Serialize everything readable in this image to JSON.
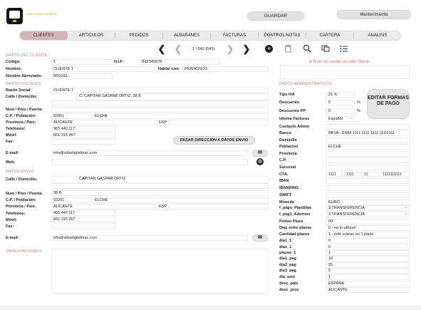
{
  "app": {
    "brand": "VIDA DIGITAL MAC",
    "guardar": "GUARDAR",
    "mantenimiento": "Mantenimiento"
  },
  "tabs": [
    "CLIENTES",
    "ARTICULOS",
    "PEDIDOS",
    "ALBARANES",
    "FACTURAS",
    "CONTROL NOTAS",
    "CARTERA",
    "ANALISIS"
  ],
  "nav": {
    "first": "❮",
    "prev": "❮",
    "record": "1 / 643 (643)",
    "next": "❯",
    "last": "❯"
  },
  "sections": {
    "cliente": "DATOS DEL CLIENTE:",
    "fiscales": "DATOS FISCALES:",
    "envio": "DATOS ENVIO:",
    "observaciones": "OBSERVACIONES:",
    "admin": "DATOS ADMINISTRATIVOS"
  },
  "cliente": {
    "codigo_l": "Código:",
    "codigo": "1",
    "nif_l": "N.I.F:",
    "nif": "B12345678",
    "nombre_l": "Nombre:",
    "nombre": "CLIENTE 1",
    "hablar_l": "Hablar con:",
    "hablar": "FRANCISCO",
    "abrev_l": "Nombre Abreviado:",
    "abrev": "MIGUEL"
  },
  "fiscal": {
    "razon_l": "Razón Social:",
    "razon": "CLIENTE 1",
    "calle_l": "Calle / Domicilio:",
    "calle": "C/ CAPITAN GASPAR ORTIZ, 38 B",
    "num_l": "Num / Piso / Puerta:",
    "cp_l": "C.P. / Población:",
    "cp": "03201",
    "pob": "ELCHE",
    "prov_l": "Provincia / País:",
    "prov": "ALICANTE",
    "pais": "ESP",
    "tel_l": "Telefonos:",
    "tel": "965 440 117",
    "movil_l": "Móvil:",
    "movil": "661 315 367",
    "fax_l": "Fax:",
    "btn": "PASAR DIRECCION A DATOS ENVIO",
    "email_l": "E-mail:",
    "email": "info@vidadigitalmac.com",
    "web_l": "Web:"
  },
  "envio": {
    "calle_l": "Calle / Domicilio:",
    "calle": "CAPITAN GASPAR ORTIZ",
    "num_l": "Num / Piso / Puerta:",
    "num": "38 B",
    "cp_l": "C.P. / Población:",
    "cp": "03201",
    "pob": "ELCHE",
    "prov_l": "Provincia / País:",
    "prov": "ALICANTE",
    "pais": "ESP",
    "tel_l": "Telefonos:",
    "tel": "965 440 117",
    "movil_l": "Móvil:",
    "movil": "661 315 367",
    "fax_l": "Fax:",
    "email_l": "E-mail:",
    "email": "info@vidadigitalmac.com"
  },
  "aviso": "A Tener en cuenta con este Cliente",
  "editar": "EDITAR FORMAS DE PAGO",
  "admin": [
    {
      "l": "Tipo IVA",
      "v": "21 %"
    },
    {
      "l": "Descuento",
      "v": "0",
      "u": "%"
    },
    {
      "l": "Descuento PP",
      "v": "0",
      "u": "%"
    },
    {
      "l": "Idioma Facturas",
      "v": "Español"
    },
    {
      "l": "Contacto Admin",
      "v": ""
    },
    {
      "l": "Banco",
      "v": "BBVA - ES89 1111 1111 1111 11111111"
    },
    {
      "l": "Domicilio",
      "v": ""
    },
    {
      "l": "Poblacion",
      "v": "ELCHE"
    },
    {
      "l": "Provincia",
      "v": ""
    },
    {
      "l": "C.P.",
      "v": ""
    },
    {
      "l": "Sucursal",
      "v": ""
    },
    {
      "l": "CTA.",
      "v": ""
    },
    {
      "l": "IBAN",
      "v": ""
    },
    {
      "l": "IBANDING",
      "v": ""
    },
    {
      "l": "SWIFT",
      "v": ""
    },
    {
      "l": "Moneda",
      "v": "EURO"
    },
    {
      "l": "f_pago_Plantillas",
      "v": "3 TRANSFERENCIA"
    },
    {
      "l": "f_pag1_Adornos",
      "v": "3 TRANSFERENCIA"
    },
    {
      "l": "Primer Plazo",
      "v": "60"
    },
    {
      "l": "Dias entre plazos",
      "v": "0 - no lo utilizan"
    },
    {
      "l": "Cantidad plazos",
      "v": "1 - sólo cobran en 1 plazo"
    },
    {
      "l": "dia1_1",
      "v": "0"
    },
    {
      "l": "dias_1",
      "v": "0"
    },
    {
      "l": "plazos_1",
      "v": "1"
    },
    {
      "l": "dia1_pag",
      "v": "10"
    },
    {
      "l": "dia2_pag",
      "v": "25"
    },
    {
      "l": "dia3_pag",
      "v": "0"
    },
    {
      "l": "dia_sem",
      "v": "1"
    },
    {
      "l": "desc_pais",
      "v": "ESPAÑA"
    },
    {
      "l": "desc_prov",
      "v": "ALICANTE"
    }
  ],
  "cta": [
    "1111",
    "1111",
    "11",
    "1111111111"
  ]
}
